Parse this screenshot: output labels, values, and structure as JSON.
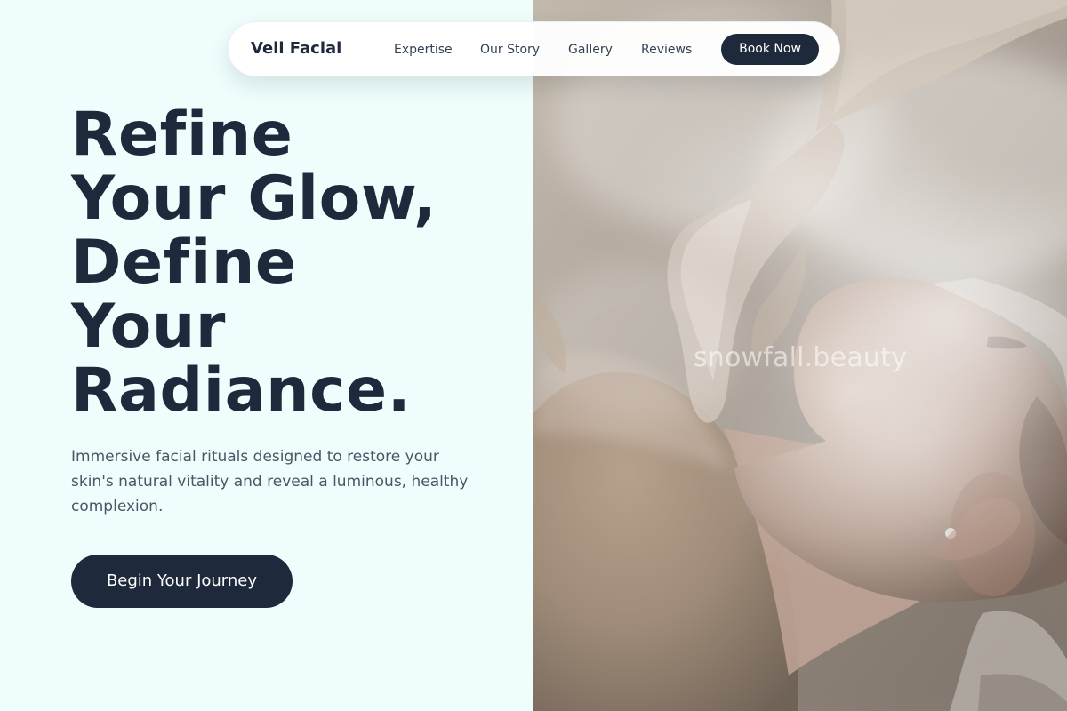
{
  "navigation": {
    "brand": "Veil Facial",
    "links": [
      {
        "label": "Expertise"
      },
      {
        "label": "Our Story"
      },
      {
        "label": "Gallery"
      },
      {
        "label": "Reviews"
      }
    ],
    "book_label": "Book Now"
  },
  "hero": {
    "headline_lines": [
      "Refine",
      "Your Glow,",
      "Define",
      "Your",
      "Radiance."
    ],
    "subtitle": "Immersive facial rituals designed to restore your skin's natural vitality and reveal a luminous, healthy complexion.",
    "cta_label": "Begin Your Journey",
    "watermark": "snowfall.beauty"
  },
  "colors": {
    "page_background": "#effefd",
    "ink": "#1e293b",
    "button_background": "#1e293b",
    "body_text": "#4b5563",
    "button_text": "#ffffff"
  },
  "icons": {
    "decorative_icons": []
  }
}
